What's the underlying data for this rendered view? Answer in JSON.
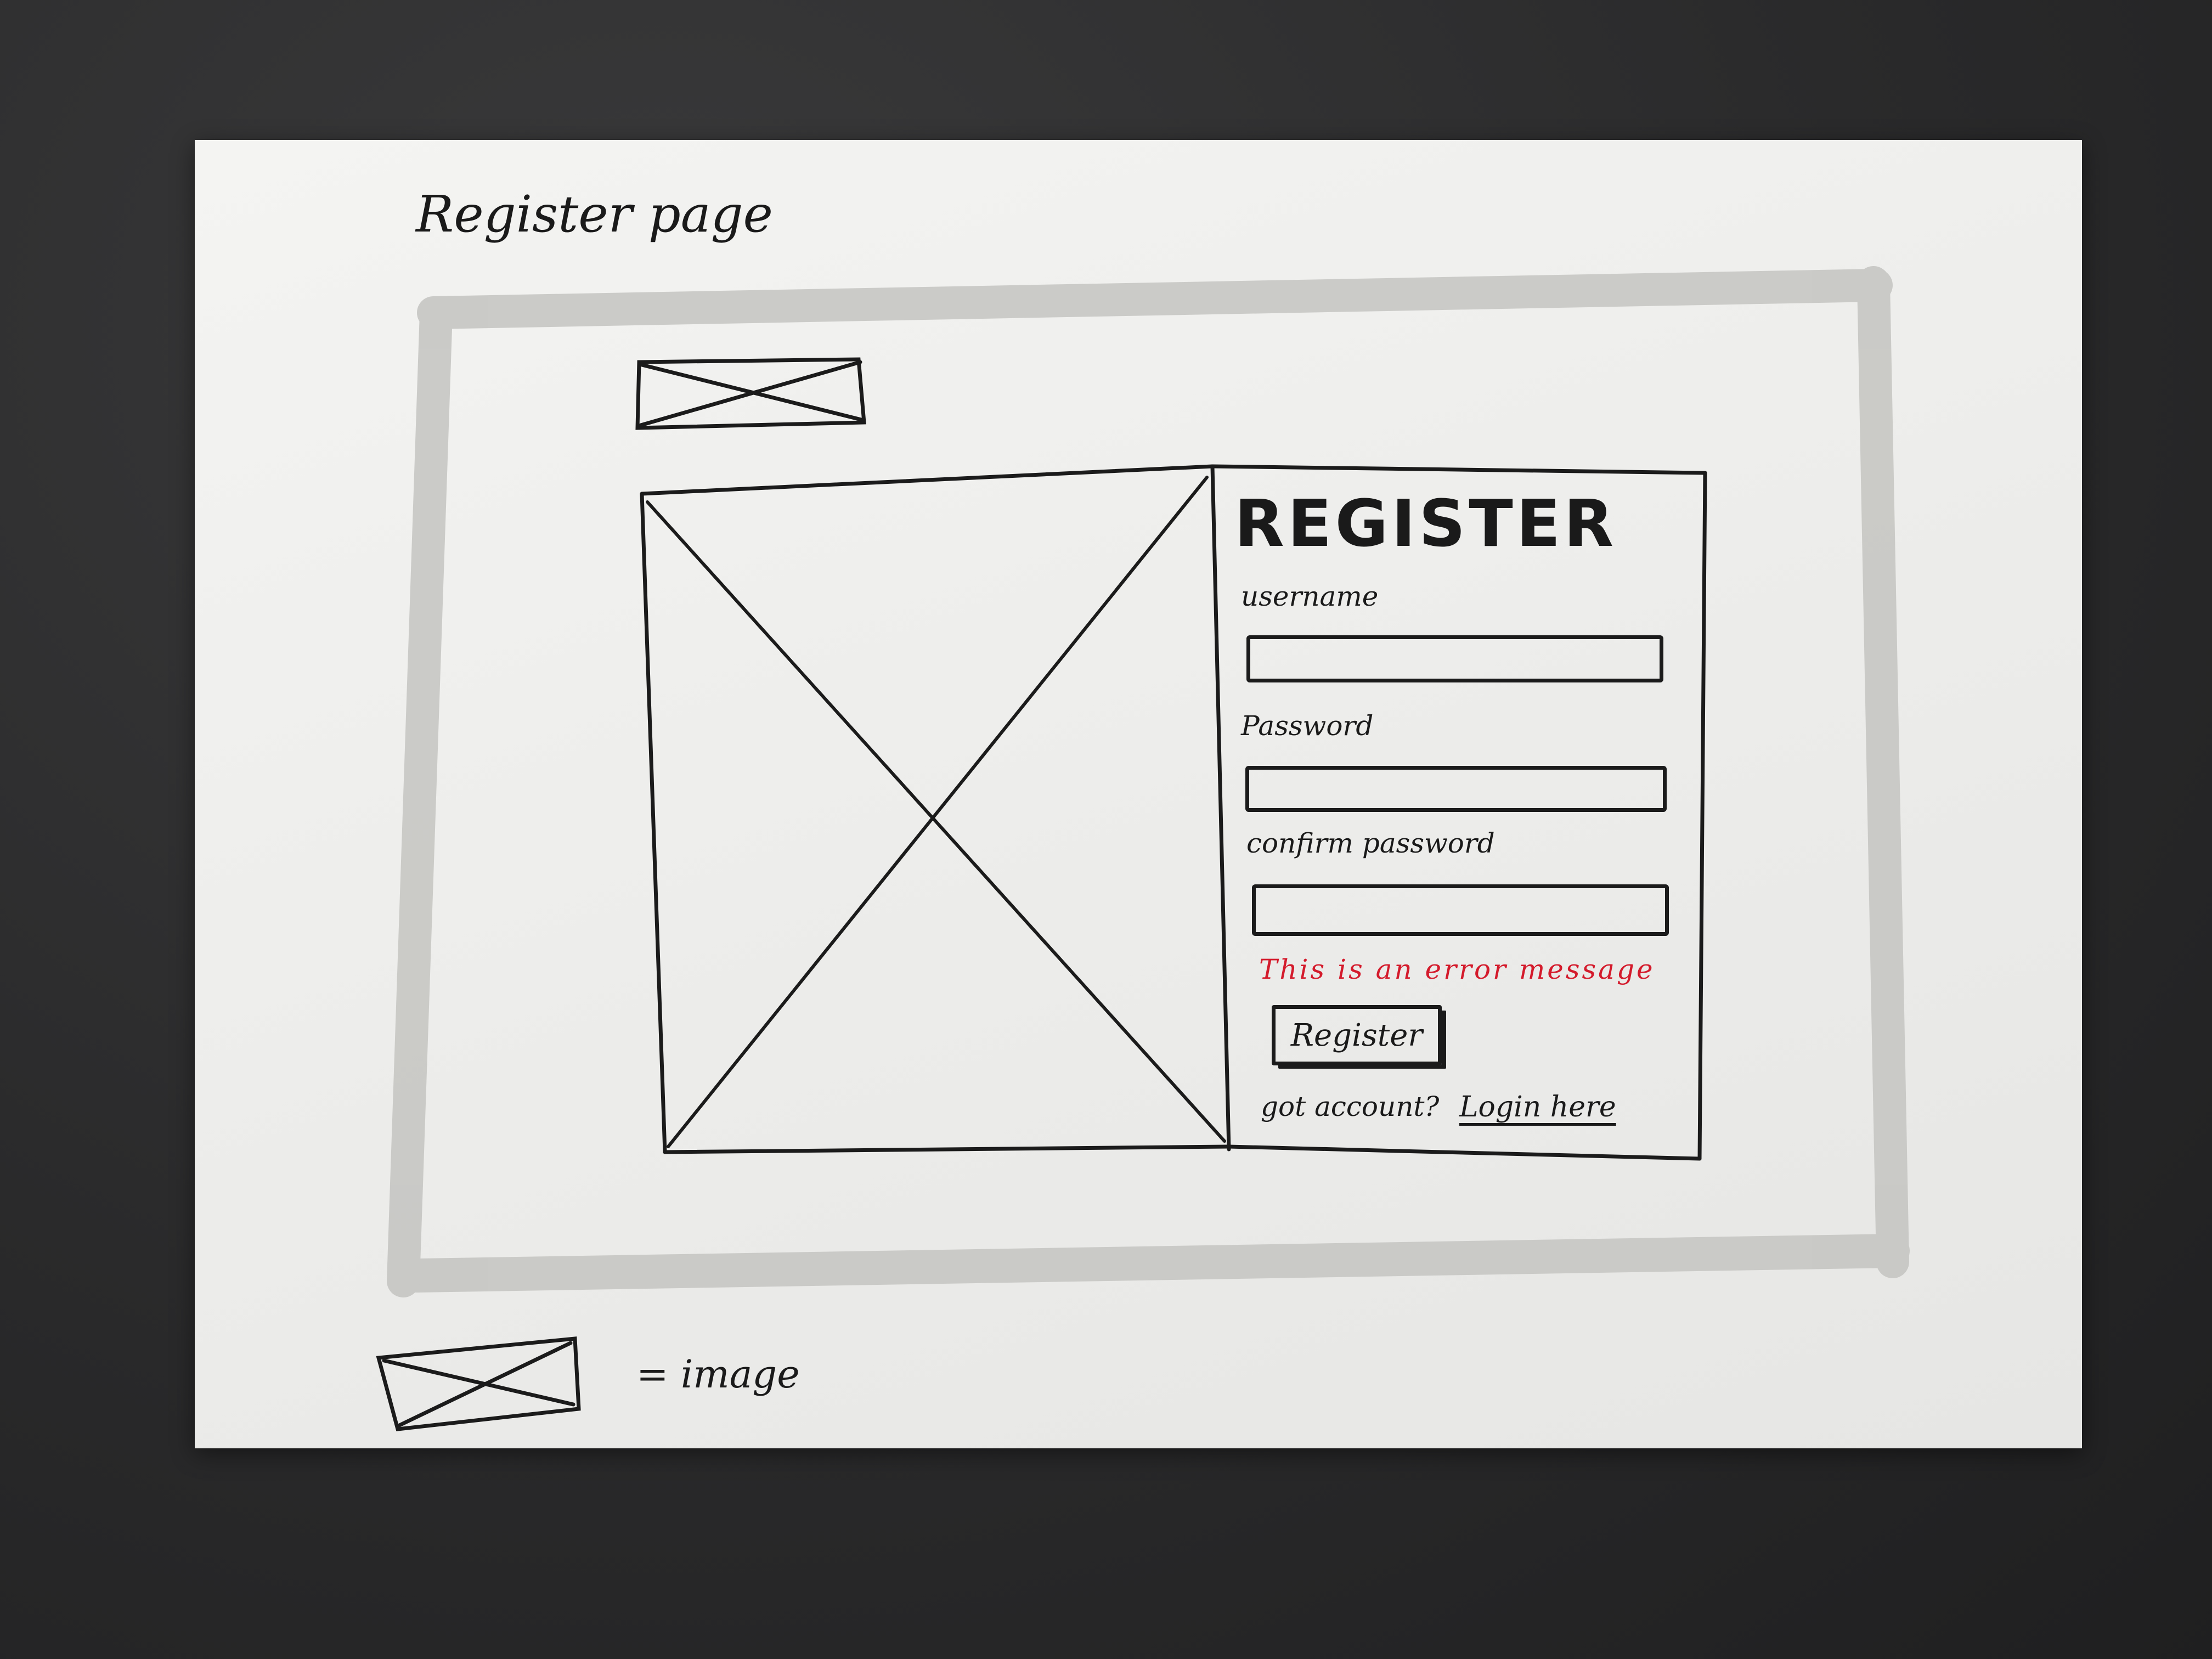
{
  "page": {
    "title": "Register page"
  },
  "form": {
    "heading": "Register",
    "username_label": "username",
    "password_label": "Password",
    "confirm_label": "confirm password",
    "error_message": "This is an error message",
    "register_button": "Register",
    "account_prompt": "got account?",
    "login_link": "Login here"
  },
  "legend": {
    "text": "= image"
  },
  "colors": {
    "ink": "#1b1b1b",
    "error": "#d41b2c",
    "paper": "#efefed",
    "frame_marker": "#c8c8c5"
  }
}
